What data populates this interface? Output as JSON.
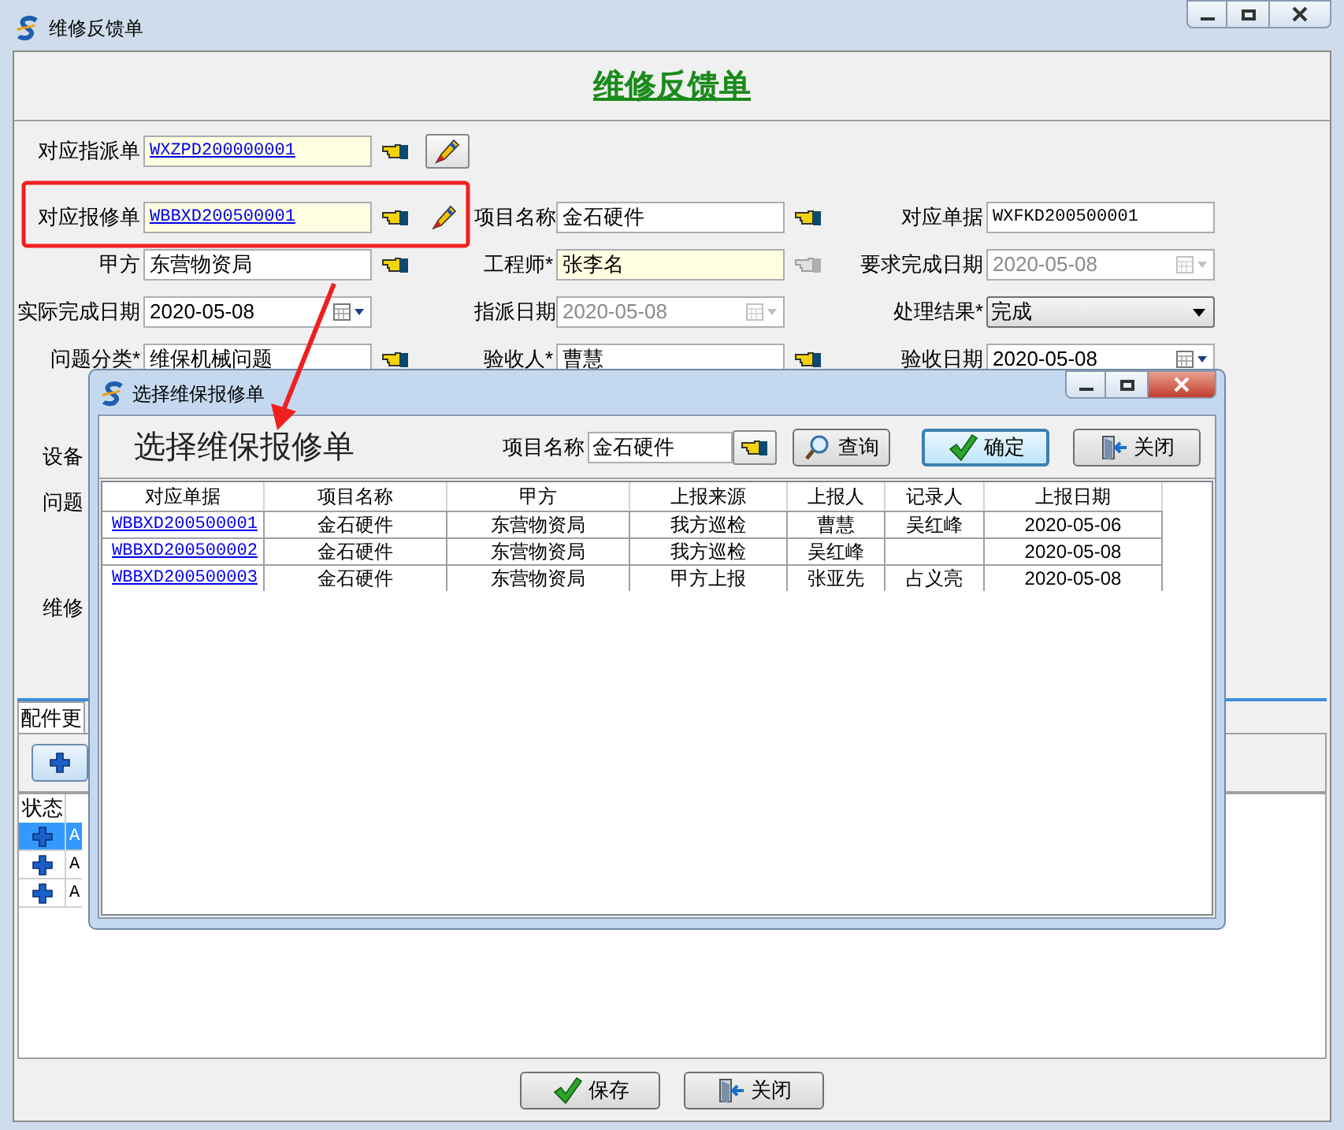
{
  "window": {
    "title": "维修反馈单"
  },
  "form": {
    "title": "维修反馈单",
    "rows": [
      {
        "fields": [
          {
            "label": "对应指派单",
            "value": "WXZPD200000001",
            "kind": "link",
            "highlighted": true,
            "disabled": false,
            "lookup": {
              "disabled": false
            },
            "edit": {
              "framed": true
            }
          }
        ]
      },
      {
        "fields": [
          {
            "label": "对应报修单",
            "value": "WBBXD200500001",
            "kind": "link",
            "highlighted": true,
            "disabled": false,
            "lookup": {
              "disabled": false
            },
            "edit": {
              "framed": false
            }
          },
          {
            "label": "项目名称",
            "value": "金石硬件",
            "kind": "text",
            "highlighted": false,
            "disabled": false,
            "lookup": {
              "disabled": false
            }
          },
          {
            "label": "对应单据",
            "value": "WXFKD200500001",
            "kind": "code",
            "highlighted": false,
            "disabled": false
          }
        ]
      },
      {
        "fields": [
          {
            "label": "甲方",
            "value": "东营物资局",
            "kind": "text",
            "highlighted": false,
            "disabled": false,
            "lookup": {
              "disabled": false
            }
          },
          {
            "label": "工程师*",
            "value": "张李名",
            "kind": "text",
            "highlighted": true,
            "disabled": false,
            "lookup": {
              "disabled": true
            }
          },
          {
            "label": "要求完成日期",
            "value": "2020-05-08",
            "kind": "date",
            "highlighted": false,
            "disabled": true
          }
        ]
      },
      {
        "fields": [
          {
            "label": "实际完成日期",
            "value": "2020-05-08",
            "kind": "date",
            "highlighted": false,
            "disabled": false
          },
          {
            "label": "指派日期",
            "value": "2020-05-08",
            "kind": "date",
            "highlighted": false,
            "disabled": true
          },
          {
            "label": "处理结果*",
            "value": "完成",
            "kind": "select",
            "highlighted": false,
            "disabled": false
          }
        ]
      },
      {
        "fields": [
          {
            "label": "问题分类*",
            "value": "维保机械问题",
            "kind": "text",
            "highlighted": false,
            "disabled": false,
            "lookup": {
              "disabled": false
            }
          },
          {
            "label": "验收人*",
            "value": "曹慧",
            "kind": "text",
            "highlighted": false,
            "disabled": false,
            "lookup": {
              "disabled": false
            }
          },
          {
            "label": "验收日期",
            "value": "2020-05-08",
            "kind": "date",
            "highlighted": false,
            "disabled": false
          }
        ]
      }
    ],
    "partial_labels": [
      "设备",
      "问题",
      "维修"
    ]
  },
  "parts": {
    "tab": "配件更",
    "header": "状态",
    "rows": [
      {
        "text": "A",
        "selected": true
      },
      {
        "text": "A",
        "selected": false
      },
      {
        "text": "A",
        "selected": false
      }
    ]
  },
  "footer": {
    "buttons": [
      {
        "label": "保存"
      },
      {
        "label": "关闭"
      }
    ]
  },
  "dialog": {
    "title": "选择维保报修单",
    "heading": "选择维保报修单",
    "filter": {
      "label": "项目名称",
      "value": "金石硬件"
    },
    "buttons": [
      {
        "label": "查询",
        "focused": false
      },
      {
        "label": "确定",
        "focused": true
      },
      {
        "label": "关闭",
        "focused": false
      }
    ],
    "table": {
      "columns": [
        "对应单据",
        "项目名称",
        "甲方",
        "上报来源",
        "上报人",
        "记录人",
        "上报日期"
      ],
      "rows": [
        {
          "id": "WBBXD200500001",
          "project": "金石硬件",
          "party": "东营物资局",
          "source": "我方巡检",
          "reporter": "曹慧",
          "recorder": "吴红峰",
          "date": "2020-05-06"
        },
        {
          "id": "WBBXD200500002",
          "project": "金石硬件",
          "party": "东营物资局",
          "source": "我方巡检",
          "reporter": "吴红峰",
          "date": "2020-05-08"
        },
        {
          "id": "WBBXD200500003",
          "project": "金石硬件",
          "party": "东营物资局",
          "source": "甲方上报",
          "reporter": "张亚先",
          "recorder": "占义亮",
          "date": "2020-05-08"
        }
      ]
    }
  },
  "annotations": {
    "frame": true,
    "arrow": true
  }
}
